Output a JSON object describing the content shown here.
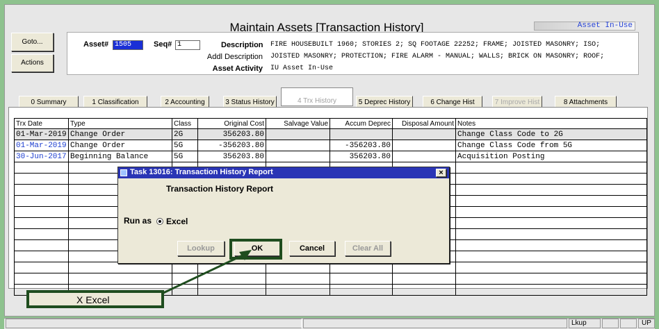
{
  "window": {
    "title": "Maintain Assets [Transaction History]",
    "status": "Asset In-Use"
  },
  "side": {
    "goto": "Goto...",
    "actions": "Actions"
  },
  "asset": {
    "asset_label": "Asset#",
    "asset_value": "1505",
    "seq_label": "Seq#",
    "seq_value": "1",
    "desc_label": "Description",
    "desc_value": "FIRE HOUSEBUILT 1960; STORIES 2; SQ FOOTAGE 22252; FRAME; JOISTED MASONRY; ISO;",
    "addl_label": "Addl Description",
    "addl_value": "JOISTED MASONRY; PROTECTION; FIRE ALARM - MANUAL; WALLS; BRICK ON MASONRY; ROOF;",
    "activity_label": "Asset Activity",
    "activity_value": "IU Asset In-Use"
  },
  "tabs": [
    {
      "label": "0 Summary"
    },
    {
      "label": "1 Classification"
    },
    {
      "label": "2 Accounting"
    },
    {
      "label": "3 Status History"
    },
    {
      "label": "4 Trx History"
    },
    {
      "label": "5 Deprec History"
    },
    {
      "label": "6 Change Hist"
    },
    {
      "label": "7 Improve Hist"
    },
    {
      "label": "8 Attachments"
    }
  ],
  "table": {
    "headers": [
      "Trx Date",
      "Type",
      "Class",
      "Original Cost",
      "Salvage Value",
      "Accum Deprec",
      "Disposal Amount",
      "Notes"
    ],
    "rows": [
      {
        "date": "01-Mar-2019",
        "type": "Change Order",
        "class": "2G",
        "orig": "356203.80",
        "salvage": "",
        "accum": "",
        "disposal": "",
        "notes": "Change Class Code to 2G"
      },
      {
        "date": "01-Mar-2019",
        "type": "Change Order",
        "class": "5G",
        "orig": "-356203.80",
        "salvage": "",
        "accum": "-356203.80",
        "disposal": "",
        "notes": "Change Class Code from 5G"
      },
      {
        "date": "30-Jun-2017",
        "type": "Beginning Balance",
        "class": "5G",
        "orig": "356203.80",
        "salvage": "",
        "accum": "356203.80",
        "disposal": "",
        "notes": "Acquisition Posting"
      }
    ]
  },
  "dialog": {
    "title": "Task 13016: Transaction History Report",
    "heading": "Transaction History Report",
    "run_as_label": "Run as",
    "radio_label": "Excel",
    "lookup": "Lookup",
    "ok": "OK",
    "cancel": "Cancel",
    "clear": "Clear All",
    "close": "×"
  },
  "callout": {
    "text": "X Excel"
  },
  "statusbar": {
    "lkup": "Lkup",
    "up": "UP"
  }
}
